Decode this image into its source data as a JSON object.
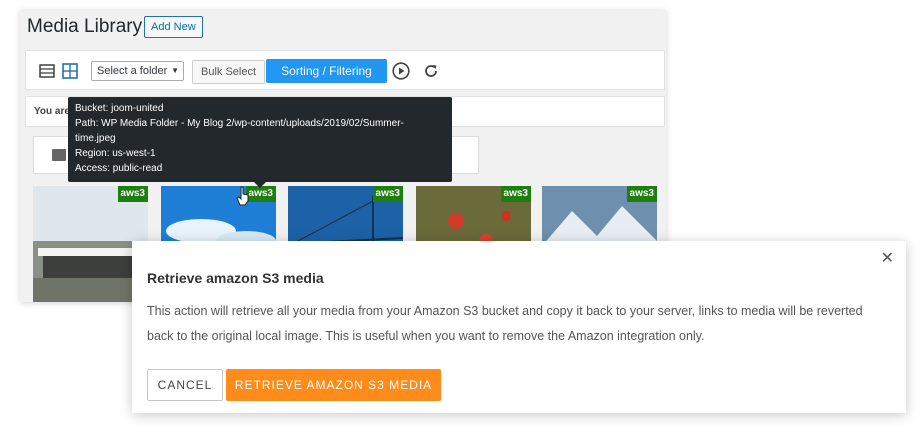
{
  "media_library": {
    "title": "Media Library",
    "add_new_label": "Add New",
    "toolbar": {
      "folder_select_value": "Select a folder",
      "bulk_select_label": "Bulk Select",
      "sorting_label": "Sorting / Filtering"
    },
    "notice_text": "You are"
  },
  "tooltip": {
    "lines": [
      "Bucket: joom-united",
      "Path: WP Media Folder - My Blog 2/wp-content/uploads/2019/02/Summer-",
      "time.jpeg",
      "Region: us-west-1",
      "Access: public-read"
    ]
  },
  "thumbnails": [
    {
      "badge": "aws3"
    },
    {
      "badge": "aws3"
    },
    {
      "badge": "aws3"
    },
    {
      "badge": "aws3"
    },
    {
      "badge": "aws3"
    }
  ],
  "dialog": {
    "title": "Retrieve amazon S3 media",
    "close": "✕",
    "body": "This action will retrieve all your media from your Amazon S3 bucket and copy it back to your server, links to media will be reverted back to the original local image. This is useful when you want to remove the Amazon integration only.",
    "cancel_label": "CANCEL",
    "retrieve_label": "RETRIEVE AMAZON S3 MEDIA"
  },
  "icons": [
    "list-view-icon",
    "grid-view-icon",
    "play-icon",
    "refresh-icon",
    "upload-icon",
    "cursor-hand-icon",
    "close-icon"
  ],
  "colors": {
    "accent_blue": "#2196f3",
    "aws_badge": "#1e7e10",
    "retrieve_orange": "#ff8c1a",
    "tooltip_bg": "#23282d"
  }
}
